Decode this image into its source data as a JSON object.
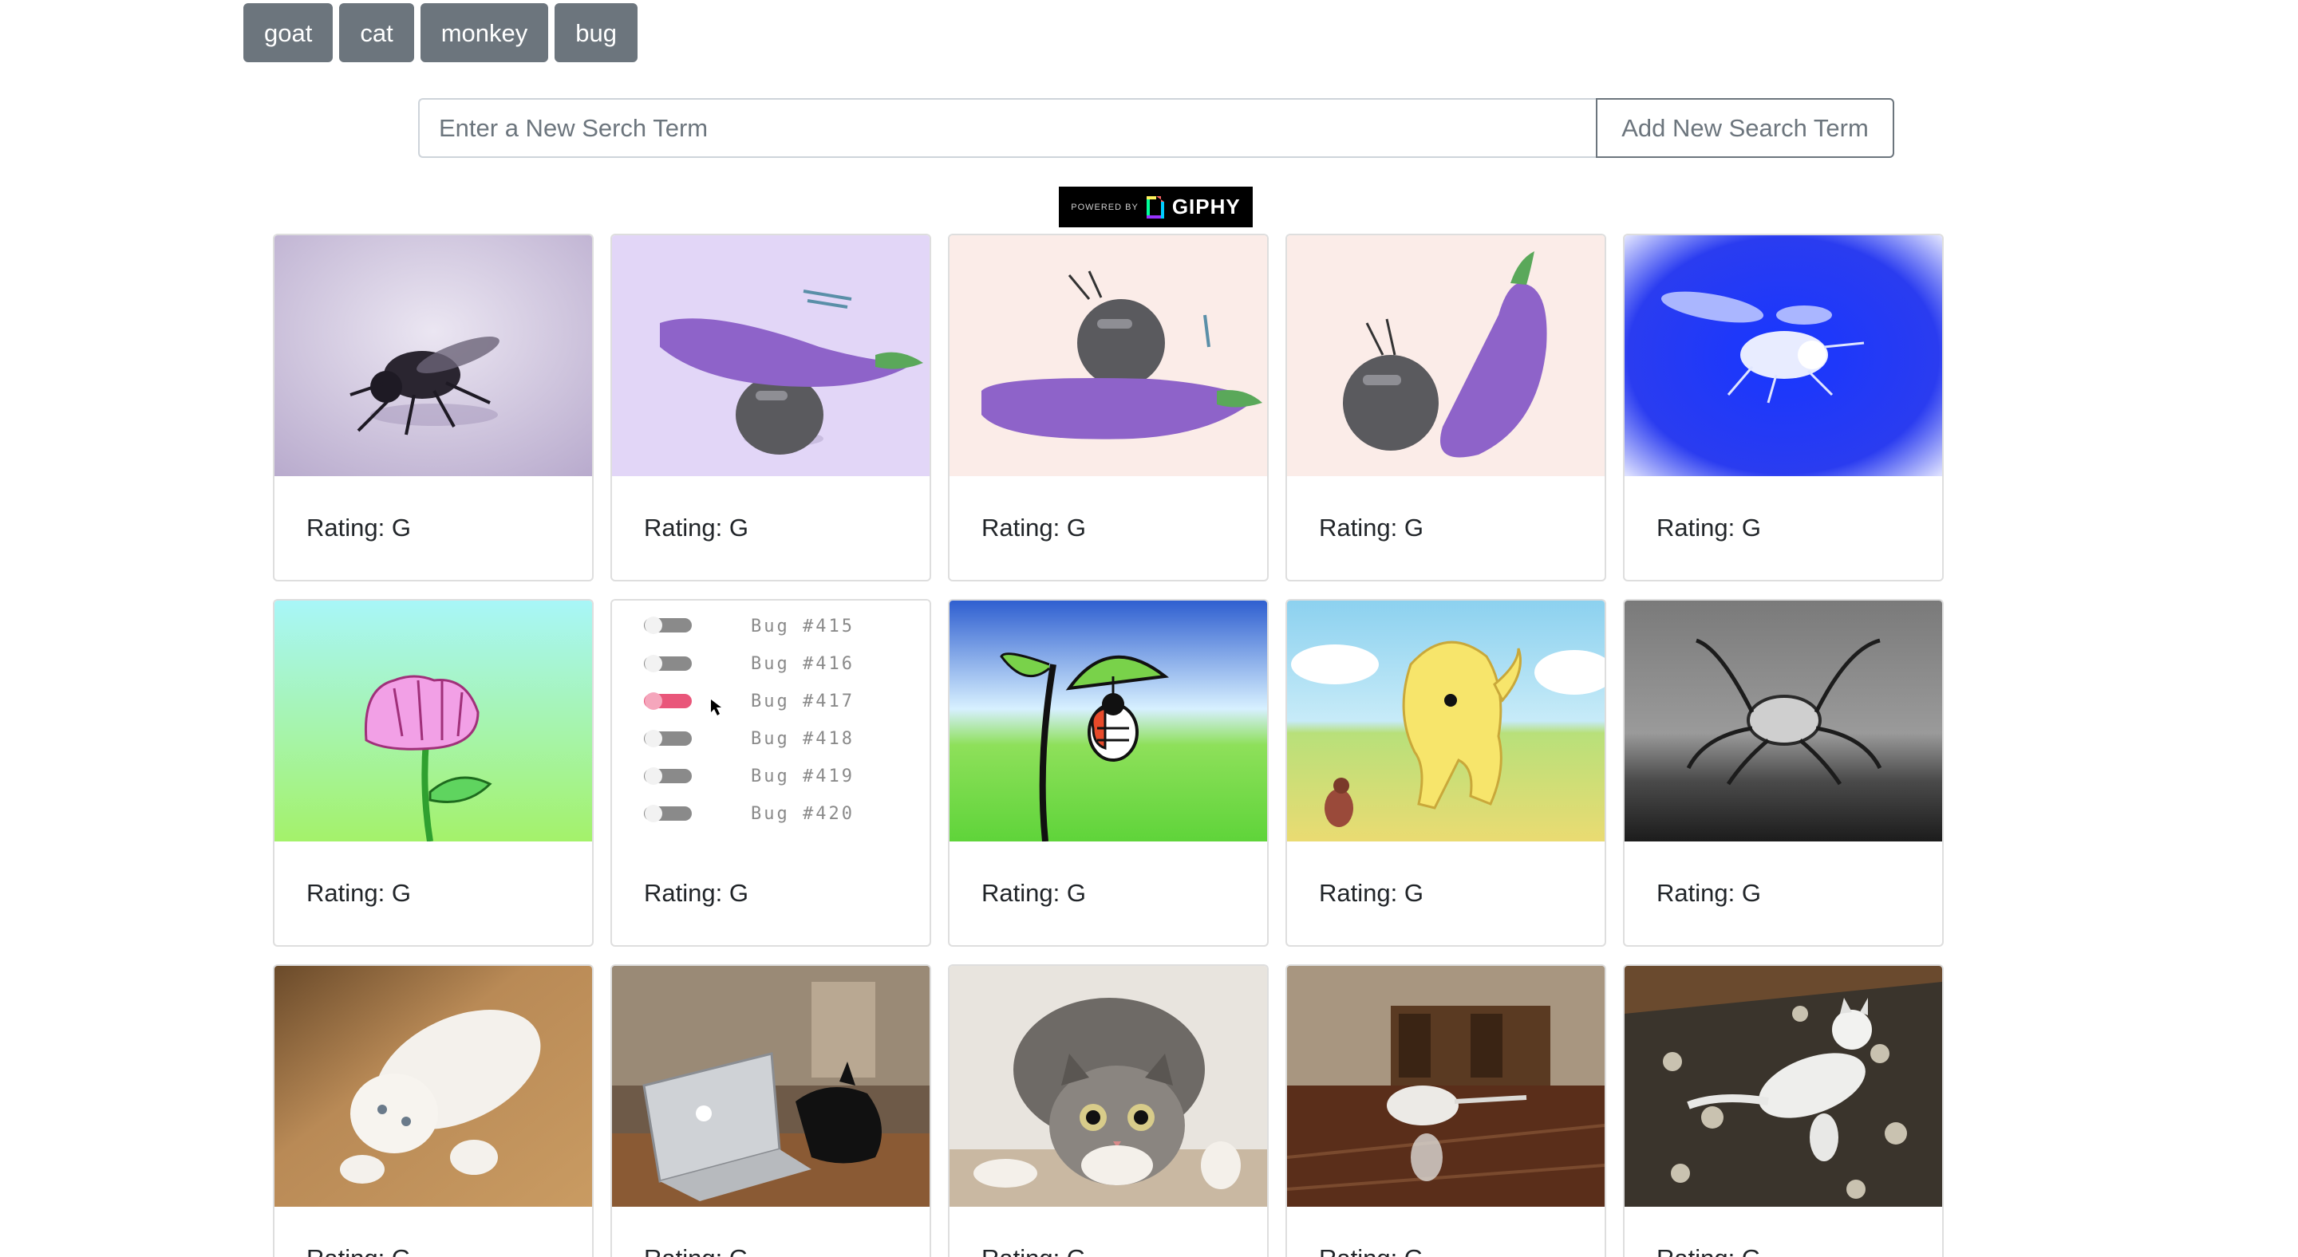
{
  "topics": [
    {
      "label": "goat"
    },
    {
      "label": "cat"
    },
    {
      "label": "monkey"
    },
    {
      "label": "bug"
    }
  ],
  "search": {
    "placeholder": "Enter a New Serch Term",
    "value": "",
    "add_label": "Add New Search Term"
  },
  "giphy": {
    "powered_by": "POWERED BY",
    "brand": "GIPHY"
  },
  "gifs": [
    {
      "rating": "Rating: G",
      "subject": "housefly"
    },
    {
      "rating": "Rating: G",
      "subject": "bug-carrying-eggplant"
    },
    {
      "rating": "Rating: G",
      "subject": "bug-riding-eggplant"
    },
    {
      "rating": "Rating: G",
      "subject": "bug-pushing-eggplant"
    },
    {
      "rating": "Rating: G",
      "subject": "blue-fly"
    },
    {
      "rating": "Rating: G",
      "subject": "pink-flower"
    },
    {
      "rating": "Rating: G",
      "subject": "bug-toggle-list",
      "list": [
        "Bug #415",
        "Bug #416",
        "Bug #417",
        "Bug #418",
        "Bug #419",
        "Bug #420"
      ]
    },
    {
      "rating": "Rating: G",
      "subject": "ladybug-leaf-umbrella"
    },
    {
      "rating": "Rating: G",
      "subject": "cartoon-dog-and-bug"
    },
    {
      "rating": "Rating: G",
      "subject": "spider-robot"
    },
    {
      "rating": "Rating: G",
      "subject": "white-kitten"
    },
    {
      "rating": "Rating: G",
      "subject": "cat-behind-laptop"
    },
    {
      "rating": "Rating: G",
      "subject": "crouching-tabby-cat"
    },
    {
      "rating": "Rating: G",
      "subject": "cat-on-wood-floor"
    },
    {
      "rating": "Rating: G",
      "subject": "cat-jumping-on-rug"
    }
  ],
  "colors": {
    "topic_button": "#6c757d",
    "add_button_border": "#6c757d",
    "card_border": "#dfdfdf",
    "giphy_bg": "#000000"
  }
}
